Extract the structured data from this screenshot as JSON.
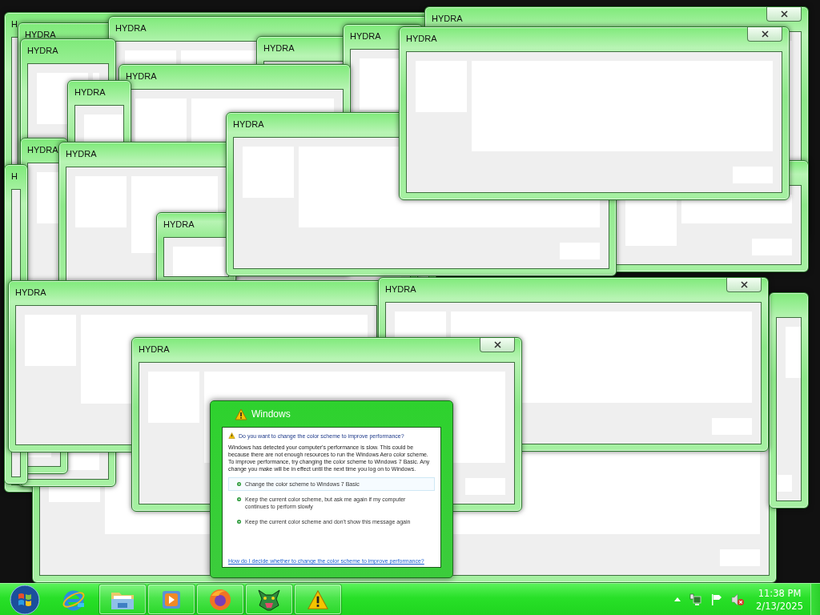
{
  "desktop": {
    "windows": [
      {
        "title": "H",
        "close_button": false
      },
      {
        "title": "HYDRA",
        "close_button": false
      },
      {
        "close_button": false
      },
      {
        "title": "HYDRA",
        "close_button": false
      },
      {
        "title": "HYDRA",
        "close_button": false
      },
      {
        "title": "HYDRA",
        "close_button": true
      },
      {
        "title": "HYDRA",
        "close_button": false
      },
      {
        "title": "HYDRA",
        "close_button": false
      },
      {
        "title": "HYDRA",
        "close_button": false
      },
      {
        "title": "HYDRA",
        "close_button": false
      },
      {
        "title": "HYDRA",
        "close_button": false
      },
      {
        "title": "H",
        "close_button": false
      },
      {
        "title": "HYDRA",
        "close_button": false
      },
      {
        "title": "HYDRA",
        "close_button": false
      },
      {
        "close_button": false
      },
      {
        "title": "HYDRA",
        "close_button": false
      },
      {
        "title": "HYDRA",
        "close_button": true
      },
      {
        "close_button": false
      },
      {
        "title": "HYDRA",
        "close_button": false
      },
      {
        "title": "HYDRA",
        "close_button": true
      },
      {
        "title": "HYDRA",
        "close_button": true
      }
    ]
  },
  "dialog": {
    "title": "Windows",
    "question": "Do you want to change the color scheme to improve performance?",
    "message": "Windows has detected your computer's performance is slow. This could be because there are not enough resources to run the Windows Aero color scheme. To improve performance, try changing the color scheme to Windows 7 Basic. Any change you make will be in effect until the next time you log on to Windows.",
    "options": [
      {
        "label": "Change the color scheme to Windows 7 Basic",
        "selected": true
      },
      {
        "label": "Keep the current color scheme, but ask me again if my computer continues to perform slowly",
        "selected": false
      },
      {
        "label": "Keep the current color scheme and don't show this message again",
        "selected": false
      }
    ],
    "link": "How do I decide whether to change the color scheme to improve performance?"
  },
  "taskbar": {
    "buttons": [
      {
        "kind": "start",
        "open": false
      },
      {
        "kind": "browser",
        "open": false
      },
      {
        "kind": "folder",
        "open": true
      },
      {
        "kind": "media",
        "open": true
      },
      {
        "kind": "globe",
        "open": true
      },
      {
        "kind": "creature",
        "open": true
      },
      {
        "kind": "warning",
        "open": true
      }
    ],
    "tray": [
      {
        "kind": "expand"
      },
      {
        "kind": "network"
      },
      {
        "kind": "flag"
      },
      {
        "kind": "speaker",
        "muted": true
      }
    ],
    "time": "11:38 PM",
    "date": "2/13/2025"
  }
}
